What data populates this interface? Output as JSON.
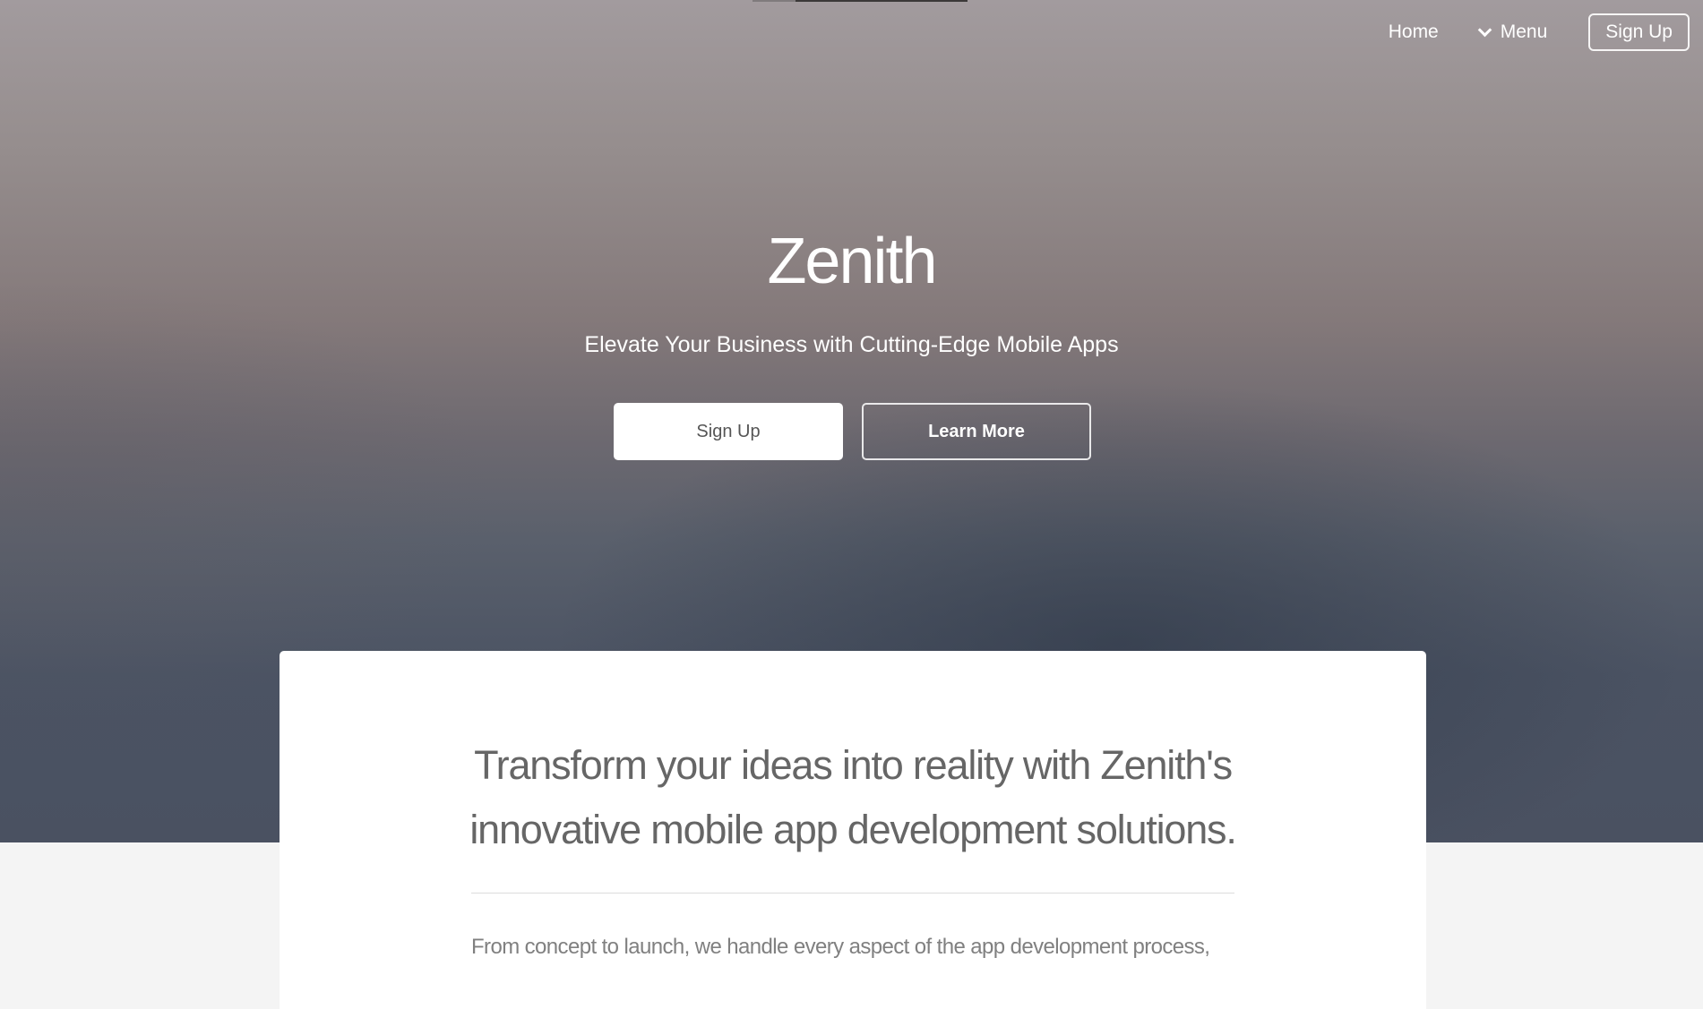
{
  "nav": {
    "home_label": "Home",
    "menu_label": "Menu",
    "signup_label": "Sign Up"
  },
  "hero": {
    "title": "Zenith",
    "subtitle": "Elevate Your Business with Cutting-Edge Mobile Apps",
    "primary_button": "Sign Up",
    "secondary_button": "Learn More"
  },
  "content": {
    "intro_line1": "Transform your ideas into reality with Zenith's",
    "intro_line2": "innovative mobile app development solutions.",
    "body_line": "From concept to launch, we handle every aspect of the app development process,"
  },
  "icons": {
    "menu_toggle": "chevron-down-icon"
  },
  "colors": {
    "hero_top": "#a29b9e",
    "hero_bottom": "#4a5161",
    "page_background": "#f4f4f4",
    "card_background": "#ffffff",
    "text_muted": "#666666"
  }
}
